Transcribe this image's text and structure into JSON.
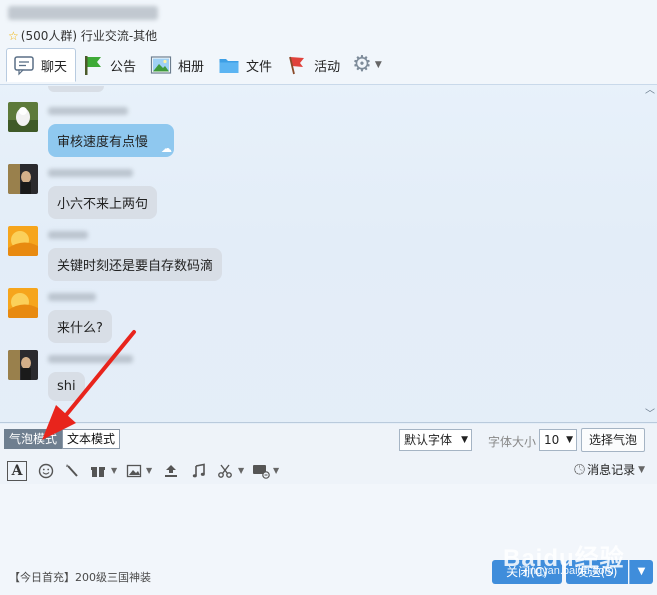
{
  "header": {
    "group_info": "(500人群) 行业交流-其他"
  },
  "tabs": [
    {
      "label": "聊天"
    },
    {
      "label": "公告"
    },
    {
      "label": "相册"
    },
    {
      "label": "文件"
    },
    {
      "label": "活动"
    }
  ],
  "messages": [
    {
      "text": "审核速度有点慢"
    },
    {
      "text": "小六不来上两句"
    },
    {
      "text": "关键时刻还是要自存数码滴"
    },
    {
      "text": "来什么?"
    },
    {
      "text": "shi"
    }
  ],
  "modebar": {
    "bubble_mode": "气泡模式",
    "text_mode": "文本模式",
    "font_select": "默认字体",
    "size_label": "字体大小",
    "size_value": "10",
    "choose_bubble": "选择气泡"
  },
  "toolbar": {
    "font_icon_glyph": "A",
    "history": "消息记录"
  },
  "footer": {
    "ad": "【今日首充】200级三国神装",
    "close": "关闭(C)",
    "send": "发送(S)"
  },
  "watermark": {
    "logo": "Baidu经验",
    "url": "jingyan.baidu.com"
  },
  "colors": {
    "accent": "#3f8ddb",
    "bubble_self": "#8fc8ef",
    "bubble_other": "#d8dee6",
    "arrow": "#e8241c"
  }
}
